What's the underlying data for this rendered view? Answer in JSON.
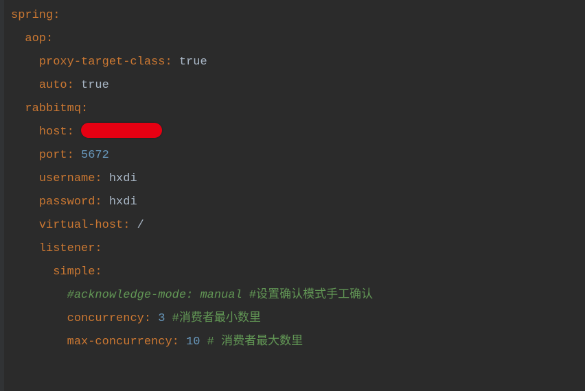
{
  "lines": {
    "spring": "spring:",
    "aop": "aop:",
    "proxy_target_class_key": "proxy-target-class:",
    "proxy_target_class_val": "true",
    "auto_key": "auto:",
    "auto_val": "true",
    "rabbitmq": "rabbitmq:",
    "host_key": "host:",
    "port_key": "port:",
    "port_val": "5672",
    "username_key": "username:",
    "username_val": "hxdi",
    "password_key": "password:",
    "password_val": "hxdi",
    "vhost_key": "virtual-host:",
    "vhost_val": "/",
    "listener": "listener:",
    "simple": "simple:",
    "ack_comment_italic": "#acknowledge-mode: manual",
    "ack_comment_rest": " #设置确认模式手工确认",
    "concurrency_key": "concurrency:",
    "concurrency_val": "3",
    "concurrency_comment": " #消费者最小数里",
    "max_conc_key": "max-concurrency:",
    "max_conc_val": "10",
    "max_conc_comment": " # 消费者最大数里"
  }
}
